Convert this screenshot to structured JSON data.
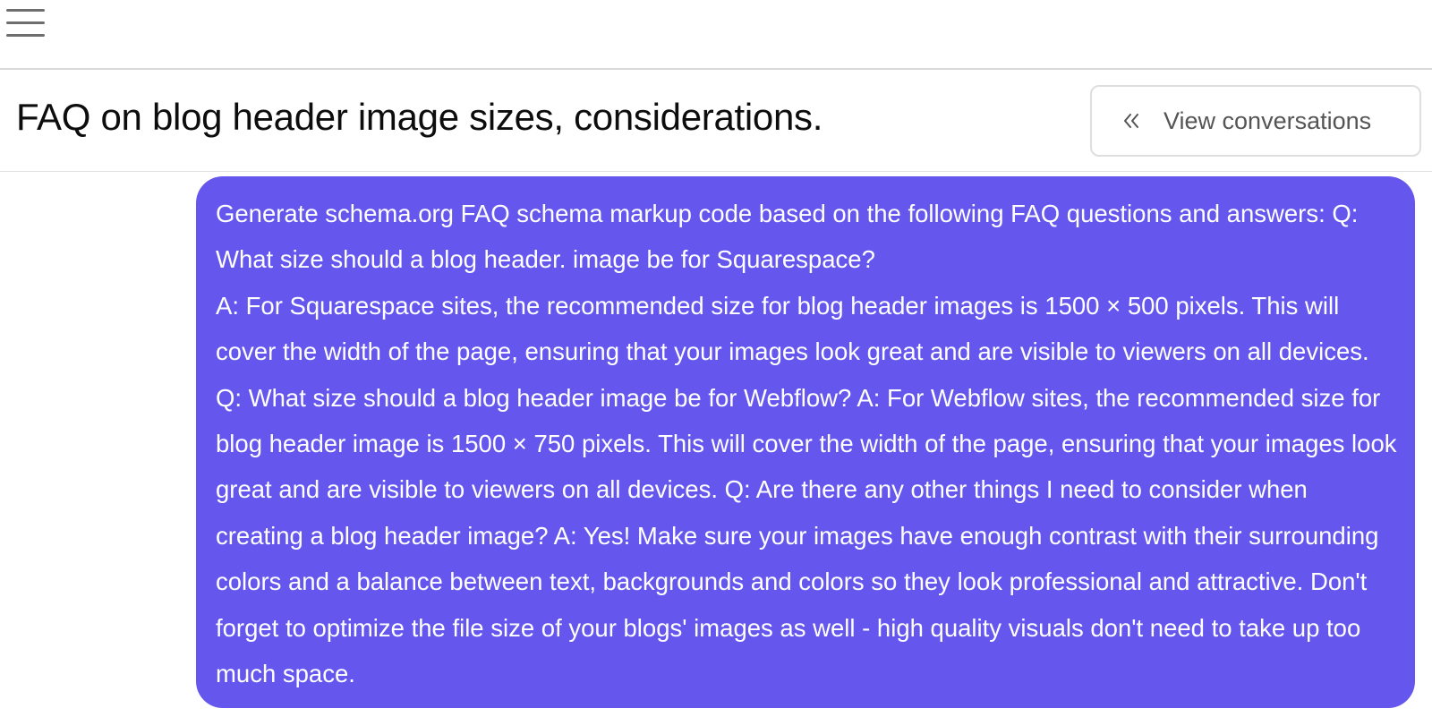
{
  "header": {
    "menu_icon": "hamburger-menu-icon"
  },
  "title_bar": {
    "title": "FAQ on blog header image sizes, considerations.",
    "view_conversations_label": "View conversations",
    "view_conversations_icon": "double-chevron-left-icon"
  },
  "message": {
    "highlighted_text": "Generate schema.org FAQ schema markup code based on the following",
    "line1_rest": " FAQ questions and answers: Q: What size should a blog header. image be for Squarespace?",
    "body": "A: For Squarespace sites, the recommended size for blog header images is 1500 × 500 pixels. This will cover the width of the page, ensuring that your images look great and are visible to viewers on all devices. Q: What size should a blog header image be for Webflow? A: For Webflow sites, the recommended size for blog header image is 1500 × 750 pixels. This will cover the width of the page, ensuring that your images look great and are visible to viewers on all devices. Q: Are there any other things I need to consider when creating a blog header image? A: Yes! Make sure your images have enough contrast with their surrounding colors and a balance between text, backgrounds and colors so they look professional and attractive. Don't forget to optimize the file size of your blogs' images as well - high quality visuals don't need to take up too much space."
  },
  "colors": {
    "bubble_background": "#6557ee",
    "highlight_underline": "#c07ff4",
    "border": "#d9d9d9"
  }
}
